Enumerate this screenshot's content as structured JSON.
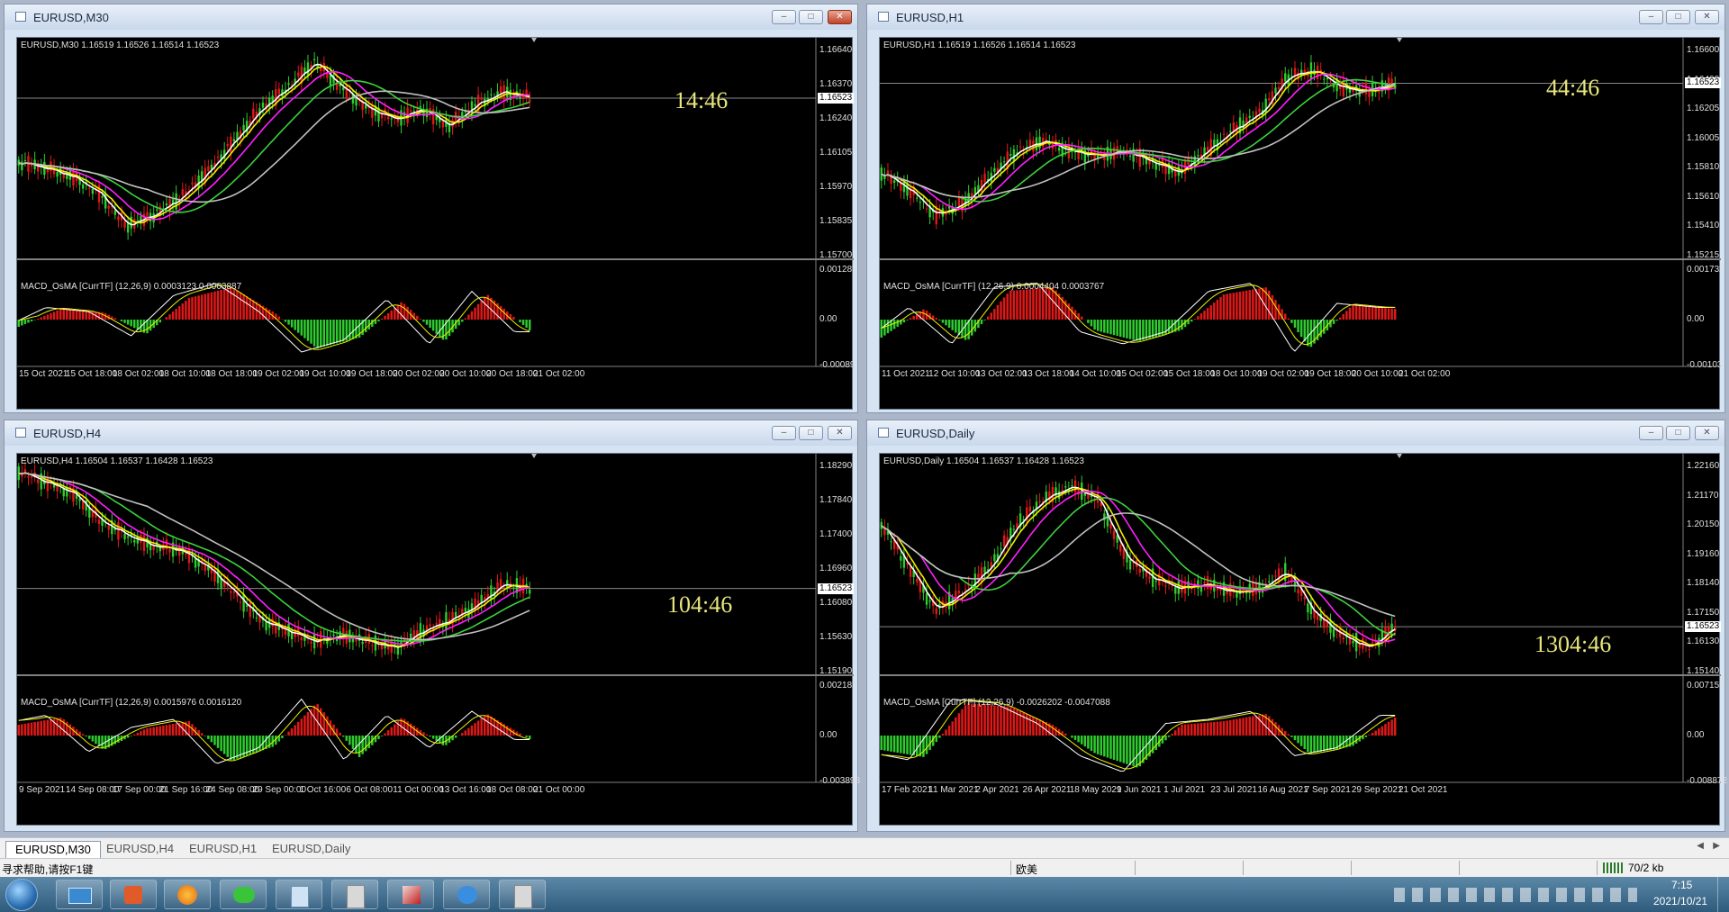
{
  "windows": [
    {
      "key": "m30",
      "title": "EURUSD,M30",
      "symbol_line": "EURUSD,M30  1.16519 1.16526 1.16514 1.16523",
      "price_axis": [
        "1.16640",
        "1.16370",
        "1.16240",
        "1.16105",
        "1.15970",
        "1.15835",
        "1.15700"
      ],
      "current_price": "1.16523",
      "countdown": "14:46",
      "osma_label": "MACD_OsMA [CurrTF] (12,26,9) 0.0003123 0.0003887",
      "osma_axis": [
        "0.001287",
        "0.00",
        "-0.00089"
      ],
      "date_axis": [
        "15 Oct 2021",
        "15 Oct 18:00",
        "18 Oct 02:00",
        "18 Oct 10:00",
        "18 Oct 18:00",
        "19 Oct 02:00",
        "19 Oct 10:00",
        "19 Oct 18:00",
        "20 Oct 02:00",
        "20 Oct 10:00",
        "20 Oct 18:00",
        "21 Oct 02:00"
      ]
    },
    {
      "key": "h1",
      "title": "EURUSD,H1",
      "symbol_line": "EURUSD,H1  1.16519 1.16526 1.16514 1.16523",
      "price_axis": [
        "1.16600",
        "1.16400",
        "1.16205",
        "1.16005",
        "1.15810",
        "1.15610",
        "1.15410",
        "1.15215"
      ],
      "current_price": "1.16523",
      "countdown": "44:46",
      "osma_label": "MACD_OsMA [CurrTF] (12,26,9) 0.0004404 0.0003767",
      "osma_axis": [
        "0.001732",
        "0.00",
        "-0.00103"
      ],
      "date_axis": [
        "11 Oct 2021",
        "12 Oct 10:00",
        "13 Oct 02:00",
        "13 Oct 18:00",
        "14 Oct 10:00",
        "15 Oct 02:00",
        "15 Oct 18:00",
        "18 Oct 10:00",
        "19 Oct 02:00",
        "19 Oct 18:00",
        "20 Oct 10:00",
        "21 Oct 02:00"
      ]
    },
    {
      "key": "h4",
      "title": "EURUSD,H4",
      "symbol_line": "EURUSD,H4  1.16504 1.16537 1.16428 1.16523",
      "price_axis": [
        "1.18290",
        "1.17840",
        "1.17400",
        "1.16960",
        "1.16080",
        "1.15630",
        "1.15190"
      ],
      "current_price": "1.16523",
      "countdown": "104:46",
      "osma_label": "MACD_OsMA [CurrTF] (12,26,9) 0.0015976 0.0016120",
      "osma_axis": [
        "0.002182",
        "0.00",
        "-0.003898"
      ],
      "date_axis": [
        "9 Sep 2021",
        "14 Sep 08:00",
        "17 Sep 00:00",
        "21 Sep 16:00",
        "24 Sep 08:00",
        "29 Sep 00:00",
        "1 Oct 16:00",
        "6 Oct 08:00",
        "11 Oct 00:00",
        "13 Oct 16:00",
        "18 Oct 08:00",
        "21 Oct 00:00"
      ]
    },
    {
      "key": "daily",
      "title": "EURUSD,Daily",
      "symbol_line": "EURUSD,Daily  1.16504 1.16537 1.16428 1.16523",
      "price_axis": [
        "1.22160",
        "1.21170",
        "1.20150",
        "1.19160",
        "1.18140",
        "1.17150",
        "1.16130",
        "1.15140"
      ],
      "current_price": "1.16523",
      "countdown": "1304:46",
      "osma_label": "MACD_OsMA [CurrTF] (12,26,9) -0.0026202 -0.0047088",
      "osma_axis": [
        "0.007155",
        "0.00",
        "-0.008872"
      ],
      "date_axis": [
        "17 Feb 2021",
        "11 Mar 2021",
        "2 Apr 2021",
        "26 Apr 2021",
        "18 May 2021",
        "9 Jun 2021",
        "1 Jul 2021",
        "23 Jul 2021",
        "16 Aug 2021",
        "7 Sep 2021",
        "29 Sep 2021",
        "21 Oct 2021"
      ]
    }
  ],
  "tabs": [
    "EURUSD,M30",
    "EURUSD,H4",
    "EURUSD,H1",
    "EURUSD,Daily"
  ],
  "status": {
    "help": "寻求帮助,请按F1键",
    "profile": "欧美",
    "traffic": "70/2 kb"
  },
  "taskbar": {
    "time": "7:15",
    "date": "2021/10/21"
  },
  "colors": {
    "bull": "#2ecc2e",
    "bear": "#e01818",
    "ma_fast": "#ffffff",
    "ma_yellow": "#f0f000",
    "ma_magenta": "#ff20ff",
    "ma_green": "#3cd23c",
    "ma_gray": "#c0c0c0",
    "countdown": "#e8e67a"
  }
}
